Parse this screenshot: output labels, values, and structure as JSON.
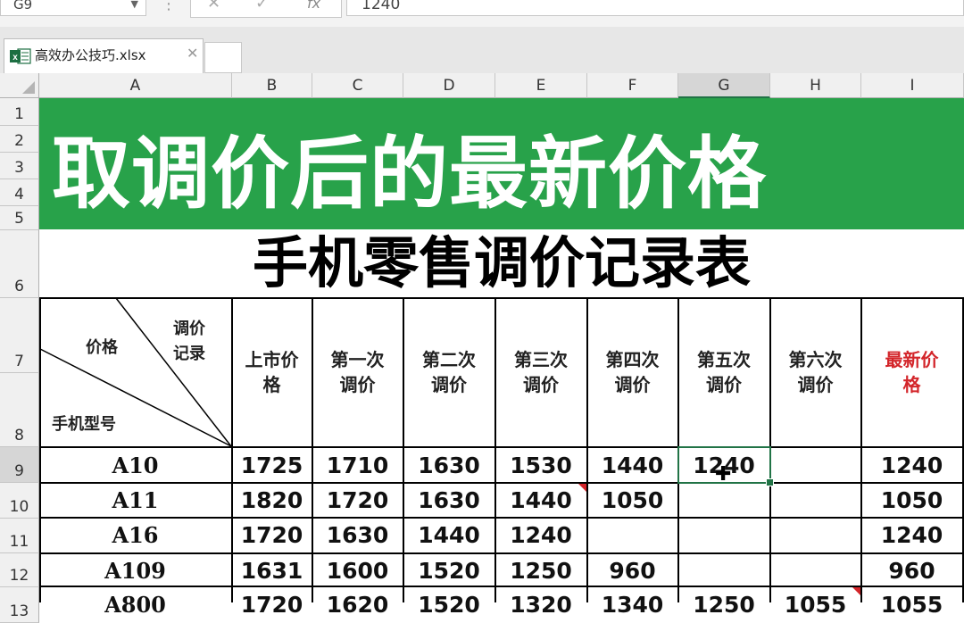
{
  "formula_bar": {
    "name_box": "G9",
    "value": "1240",
    "fx": "fx"
  },
  "tab": {
    "file_name": "高效办公技巧.xlsx"
  },
  "columns": [
    "A",
    "B",
    "C",
    "D",
    "E",
    "F",
    "G",
    "H",
    "I"
  ],
  "rows": [
    "1",
    "2",
    "3",
    "4",
    "5",
    "6",
    "7",
    "8",
    "9",
    "10",
    "11",
    "12",
    "13"
  ],
  "banner": {
    "title": "取调价后的最新价格"
  },
  "sheet": {
    "title": "手机零售调价记录表",
    "diag_header": {
      "top_right": "调价\n记录",
      "middle": "价格",
      "bottom_left": "手机型号"
    },
    "headers": [
      "上市价\n格",
      "第一次\n调价",
      "第二次\n调价",
      "第三次\n调价",
      "第四次\n调价",
      "第五次\n调价",
      "第六次\n调价",
      "最新价\n格"
    ],
    "rows": [
      {
        "model": "A10",
        "prices": [
          "1725",
          "1710",
          "1630",
          "1530",
          "1440",
          "1240",
          "",
          "1240"
        ]
      },
      {
        "model": "A11",
        "prices": [
          "1820",
          "1720",
          "1630",
          "1440",
          "1050",
          "",
          "",
          "1050"
        ]
      },
      {
        "model": "A16",
        "prices": [
          "1720",
          "1630",
          "1440",
          "1240",
          "",
          "",
          "",
          "1240"
        ]
      },
      {
        "model": "A109",
        "prices": [
          "1631",
          "1600",
          "1520",
          "1250",
          "960",
          "",
          "",
          "960"
        ]
      },
      {
        "model": "A800",
        "prices": [
          "1720",
          "1620",
          "1520",
          "1320",
          "1340",
          "1250",
          "1055",
          "1055"
        ]
      }
    ]
  },
  "colors": {
    "banner_green": "#28a24a",
    "accent_red": "#d3252a",
    "excel_green": "#217346"
  }
}
